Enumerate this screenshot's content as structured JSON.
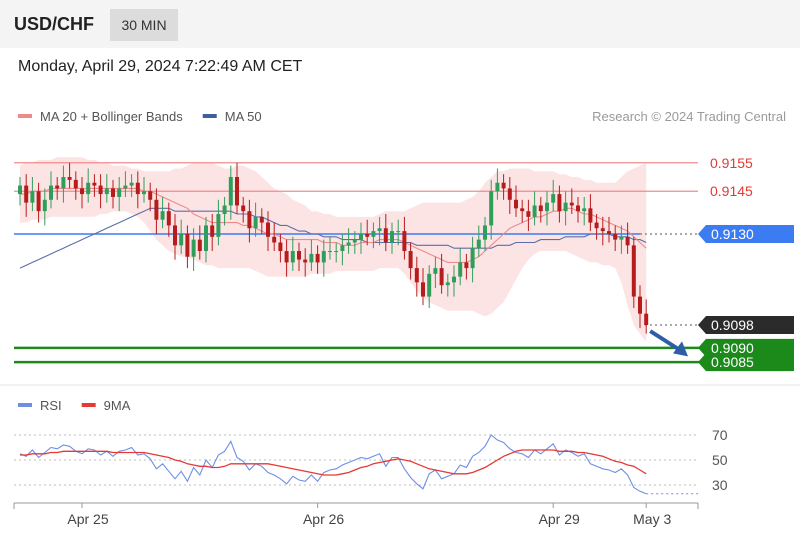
{
  "header": {
    "symbol": "USD/CHF",
    "timeframe": "30 MIN"
  },
  "datetime": "Monday, April 29, 2024 7:22:49 AM CET",
  "colors": {
    "up": "#2f9e5b",
    "down": "#b71c1c",
    "ma20": "#ef8a8a",
    "band_fill": "#fde1e1",
    "ma50": "#5a6fa8",
    "resistance": "#f28b8b",
    "pivot": "#3c7cf2",
    "support": "#1b8a1b",
    "rsi": "#6f8ee6",
    "rsi_ma": "#e53935",
    "last": "#2b2b2b",
    "arrow": "#2c5fa8"
  },
  "chart_data": [
    {
      "type": "candlestick",
      "legend": [
        {
          "label": "MA 20 + Bollinger Bands",
          "color": "#ef8a8a"
        },
        {
          "label": "MA 50",
          "color": "#3e5e9e"
        }
      ],
      "credit": "Research © 2024 Trading Central",
      "ylim": [
        0.9078,
        0.9163
      ],
      "x_ticks": [
        {
          "label": "Apr 25",
          "index": 10
        },
        {
          "label": "Apr 26",
          "index": 48
        },
        {
          "label": "Apr 29",
          "index": 86
        },
        {
          "label": "May 3",
          "index": 101
        }
      ],
      "closes": [
        0.9147,
        0.9141,
        0.9145,
        0.9138,
        0.9142,
        0.9147,
        0.9146,
        0.915,
        0.9149,
        0.9146,
        0.9144,
        0.9148,
        0.9147,
        0.9144,
        0.9146,
        0.9143,
        0.9146,
        0.9147,
        0.9148,
        0.9144,
        0.9145,
        0.9142,
        0.9135,
        0.9138,
        0.9133,
        0.9126,
        0.913,
        0.9122,
        0.9128,
        0.9124,
        0.9133,
        0.9129,
        0.9137,
        0.914,
        0.915,
        0.914,
        0.9138,
        0.9132,
        0.9136,
        0.9134,
        0.9129,
        0.9127,
        0.9124,
        0.912,
        0.9124,
        0.9121,
        0.912,
        0.9123,
        0.912,
        0.9124,
        0.9124,
        0.9124,
        0.9126,
        0.9127,
        0.9128,
        0.913,
        0.9129,
        0.9131,
        0.9132,
        0.9127,
        0.9131,
        0.9131,
        0.9124,
        0.9118,
        0.9113,
        0.9108,
        0.9116,
        0.9118,
        0.9112,
        0.9113,
        0.9115,
        0.912,
        0.9118,
        0.9125,
        0.9128,
        0.9133,
        0.9145,
        0.9148,
        0.9146,
        0.9142,
        0.9139,
        0.9138,
        0.9136,
        0.914,
        0.9138,
        0.9141,
        0.9144,
        0.9138,
        0.9141,
        0.914,
        0.9138,
        0.9139,
        0.9134,
        0.9132,
        0.9131,
        0.913,
        0.9128,
        0.9129,
        0.9126,
        0.9108,
        0.9102,
        0.9098
      ],
      "ma20": [
        0.9144,
        0.9144,
        0.9145,
        0.9145,
        0.9145,
        0.9146,
        0.9146,
        0.9146,
        0.9146,
        0.9146,
        0.9146,
        0.9146,
        0.9146,
        0.9146,
        0.9146,
        0.9146,
        0.9146,
        0.9146,
        0.9146,
        0.9146,
        0.9145,
        0.9145,
        0.9144,
        0.9143,
        0.9142,
        0.9141,
        0.914,
        0.9139,
        0.9137,
        0.9136,
        0.9135,
        0.9134,
        0.9134,
        0.9134,
        0.9134,
        0.9134,
        0.9133,
        0.9133,
        0.9132,
        0.9131,
        0.913,
        0.913,
        0.9129,
        0.9128,
        0.9128,
        0.9128,
        0.9128,
        0.9128,
        0.9128,
        0.9127,
        0.9127,
        0.9127,
        0.9126,
        0.9126,
        0.9126,
        0.9127,
        0.9127,
        0.9127,
        0.9128,
        0.9128,
        0.9128,
        0.9128,
        0.9127,
        0.9126,
        0.9125,
        0.9124,
        0.9123,
        0.9122,
        0.9121,
        0.912,
        0.912,
        0.912,
        0.912,
        0.9121,
        0.9122,
        0.9124,
        0.9126,
        0.9128,
        0.913,
        0.9132,
        0.9133,
        0.9134,
        0.9135,
        0.9136,
        0.9136,
        0.9137,
        0.9138,
        0.9138,
        0.9139,
        0.9139,
        0.9138,
        0.9137,
        0.9137,
        0.9136,
        0.9135,
        0.9134,
        0.9133,
        0.9132,
        0.9131,
        0.9129,
        0.9127,
        0.9125
      ],
      "bb_upper": [
        0.9154,
        0.9155,
        0.9155,
        0.9156,
        0.9156,
        0.9156,
        0.9157,
        0.9157,
        0.9157,
        0.9157,
        0.9157,
        0.9156,
        0.9156,
        0.9155,
        0.9155,
        0.9154,
        0.9154,
        0.9154,
        0.9153,
        0.9153,
        0.9152,
        0.9152,
        0.9152,
        0.9152,
        0.9152,
        0.9153,
        0.9153,
        0.9154,
        0.9155,
        0.9155,
        0.9155,
        0.9155,
        0.9154,
        0.9153,
        0.9153,
        0.9154,
        0.9154,
        0.9153,
        0.9152,
        0.915,
        0.9148,
        0.9146,
        0.9145,
        0.9144,
        0.9142,
        0.9141,
        0.914,
        0.9138,
        0.9138,
        0.9137,
        0.9137,
        0.9136,
        0.9136,
        0.9136,
        0.9136,
        0.9136,
        0.9136,
        0.9136,
        0.9137,
        0.9138,
        0.9138,
        0.9138,
        0.9138,
        0.9139,
        0.914,
        0.9141,
        0.9141,
        0.9141,
        0.9141,
        0.9141,
        0.9141,
        0.9141,
        0.9142,
        0.9143,
        0.9145,
        0.9148,
        0.915,
        0.9152,
        0.9152,
        0.9153,
        0.9153,
        0.9153,
        0.9153,
        0.9152,
        0.9152,
        0.9152,
        0.9152,
        0.9151,
        0.9151,
        0.915,
        0.915,
        0.9149,
        0.9149,
        0.9148,
        0.9148,
        0.9148,
        0.9148,
        0.915,
        0.9152,
        0.9153,
        0.9154,
        0.9155
      ],
      "bb_lower": [
        0.9134,
        0.9134,
        0.9135,
        0.9135,
        0.9135,
        0.9136,
        0.9136,
        0.9136,
        0.9136,
        0.9136,
        0.9136,
        0.9136,
        0.9136,
        0.9137,
        0.9137,
        0.9138,
        0.9138,
        0.9138,
        0.9137,
        0.9136,
        0.9134,
        0.9131,
        0.9128,
        0.9126,
        0.9124,
        0.9123,
        0.9122,
        0.9122,
        0.9121,
        0.912,
        0.9119,
        0.9119,
        0.9118,
        0.9118,
        0.9118,
        0.9118,
        0.9118,
        0.9118,
        0.9117,
        0.9116,
        0.9115,
        0.9115,
        0.9115,
        0.9115,
        0.9115,
        0.9115,
        0.9115,
        0.9116,
        0.9116,
        0.9116,
        0.9116,
        0.9117,
        0.9117,
        0.9117,
        0.9117,
        0.9117,
        0.9117,
        0.9117,
        0.9118,
        0.9118,
        0.9118,
        0.9118,
        0.9116,
        0.9113,
        0.911,
        0.9108,
        0.9106,
        0.9105,
        0.9104,
        0.9103,
        0.9103,
        0.9103,
        0.9103,
        0.9103,
        0.9102,
        0.9101,
        0.9102,
        0.9104,
        0.9106,
        0.911,
        0.9114,
        0.9118,
        0.9121,
        0.9123,
        0.9124,
        0.9124,
        0.9124,
        0.9124,
        0.9124,
        0.9123,
        0.9122,
        0.9121,
        0.912,
        0.912,
        0.9119,
        0.9119,
        0.9118,
        0.9113,
        0.9105,
        0.9098,
        0.9095,
        0.9092
      ],
      "ma50": [
        0.9118,
        0.9119,
        0.912,
        0.9121,
        0.9122,
        0.9123,
        0.9124,
        0.9125,
        0.9126,
        0.9127,
        0.9128,
        0.9129,
        0.913,
        0.9131,
        0.9132,
        0.9133,
        0.9134,
        0.9135,
        0.9136,
        0.9137,
        0.9138,
        0.9139,
        0.9139,
        0.9139,
        0.9139,
        0.9138,
        0.9138,
        0.9138,
        0.9138,
        0.9138,
        0.9138,
        0.9138,
        0.9138,
        0.9138,
        0.9138,
        0.9137,
        0.9137,
        0.9137,
        0.9136,
        0.9136,
        0.9135,
        0.9134,
        0.9133,
        0.9133,
        0.9132,
        0.9131,
        0.9131,
        0.913,
        0.913,
        0.9129,
        0.9129,
        0.9129,
        0.9128,
        0.9128,
        0.9128,
        0.9128,
        0.9127,
        0.9127,
        0.9127,
        0.9127,
        0.9127,
        0.9127,
        0.9127,
        0.9127,
        0.9126,
        0.9126,
        0.9126,
        0.9126,
        0.9126,
        0.9126,
        0.9125,
        0.9125,
        0.9125,
        0.9125,
        0.9125,
        0.9125,
        0.9125,
        0.9126,
        0.9126,
        0.9126,
        0.9127,
        0.9127,
        0.9127,
        0.9127,
        0.9128,
        0.9128,
        0.9128,
        0.9128,
        0.9129,
        0.9129,
        0.9129,
        0.9129,
        0.913,
        0.913,
        0.913,
        0.913,
        0.9129,
        0.9129,
        0.9129,
        0.9128,
        0.9128,
        0.9127
      ],
      "levels": [
        {
          "value": 0.9155,
          "label": "0.9155",
          "role": "resistance"
        },
        {
          "value": 0.9145,
          "label": "0.9145",
          "role": "resistance"
        },
        {
          "value": 0.913,
          "label": "0.9130",
          "role": "pivot"
        },
        {
          "value": 0.9098,
          "label": "0.9098",
          "role": "last"
        },
        {
          "value": 0.909,
          "label": "0.9090",
          "role": "support"
        },
        {
          "value": 0.9085,
          "label": "0.9085",
          "role": "support"
        }
      ]
    },
    {
      "type": "line",
      "legend": [
        {
          "label": "RSI",
          "color": "#6f8ee6"
        },
        {
          "label": "9MA",
          "color": "#e53935"
        }
      ],
      "ylim": [
        18,
        82
      ],
      "y_ticks": [
        70,
        50,
        30
      ],
      "rsi": [
        55,
        53,
        58,
        52,
        56,
        60,
        59,
        62,
        61,
        57,
        55,
        59,
        58,
        54,
        57,
        53,
        57,
        58,
        60,
        54,
        55,
        51,
        43,
        47,
        41,
        35,
        41,
        33,
        44,
        38,
        50,
        44,
        54,
        57,
        65,
        52,
        49,
        42,
        47,
        45,
        40,
        38,
        35,
        31,
        37,
        34,
        33,
        38,
        33,
        40,
        42,
        43,
        46,
        48,
        50,
        52,
        51,
        53,
        55,
        45,
        52,
        52,
        43,
        36,
        31,
        27,
        39,
        42,
        35,
        37,
        39,
        46,
        44,
        53,
        56,
        61,
        70,
        66,
        64,
        59,
        56,
        55,
        52,
        58,
        55,
        59,
        63,
        54,
        58,
        56,
        53,
        55,
        47,
        45,
        43,
        42,
        40,
        43,
        38,
        28,
        25,
        23
      ],
      "rsi_ma": [
        54,
        54,
        55,
        55,
        55,
        56,
        56,
        57,
        57,
        57,
        57,
        57,
        57,
        57,
        57,
        56,
        56,
        56,
        56,
        56,
        56,
        55,
        54,
        53,
        52,
        50,
        49,
        47,
        46,
        45,
        45,
        44,
        44,
        45,
        47,
        47,
        47,
        47,
        47,
        47,
        47,
        46,
        45,
        44,
        43,
        42,
        41,
        40,
        39,
        38,
        38,
        38,
        39,
        40,
        42,
        44,
        45,
        47,
        48,
        49,
        50,
        51,
        50,
        49,
        47,
        45,
        43,
        42,
        41,
        40,
        39,
        39,
        39,
        40,
        42,
        44,
        47,
        50,
        53,
        55,
        57,
        58,
        58,
        58,
        58,
        58,
        58,
        57,
        57,
        57,
        56,
        56,
        55,
        54,
        53,
        51,
        49,
        48,
        46,
        45,
        42,
        39
      ]
    }
  ]
}
